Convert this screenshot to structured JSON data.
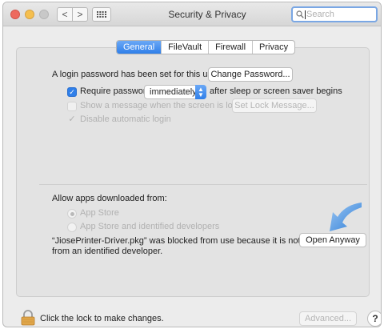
{
  "window": {
    "title": "Security & Privacy"
  },
  "toolbar": {
    "back_icon": "<",
    "forward_icon": ">"
  },
  "search": {
    "placeholder": "Search"
  },
  "tabs": [
    {
      "label": "General"
    },
    {
      "label": "FileVault"
    },
    {
      "label": "Firewall"
    },
    {
      "label": "Privacy"
    }
  ],
  "general": {
    "login_text": "A login password has been set for this user",
    "change_password_label": "Change Password...",
    "require_password_label": "Require password",
    "require_password_value": "immediately",
    "require_password_suffix": "after sleep or screen saver begins",
    "show_message_label": "Show a message when the screen is locked",
    "set_lock_message_label": "Set Lock Message...",
    "disable_auto_login_label": "Disable automatic login"
  },
  "apps": {
    "heading": "Allow apps downloaded from:",
    "options": [
      {
        "label": "App Store"
      },
      {
        "label": "App Store and identified developers"
      }
    ],
    "blocked_line1": "“JiosePrinter-Driver.pkg” was blocked from use because it is not",
    "blocked_line2": "from an identified developer.",
    "open_anyway_label": "Open Anyway"
  },
  "footer": {
    "lock_text": "Click the lock to make changes.",
    "advanced_label": "Advanced...",
    "help_label": "?"
  },
  "colors": {
    "accent": "#2f7fe9",
    "arrow": "#4a90d9"
  }
}
